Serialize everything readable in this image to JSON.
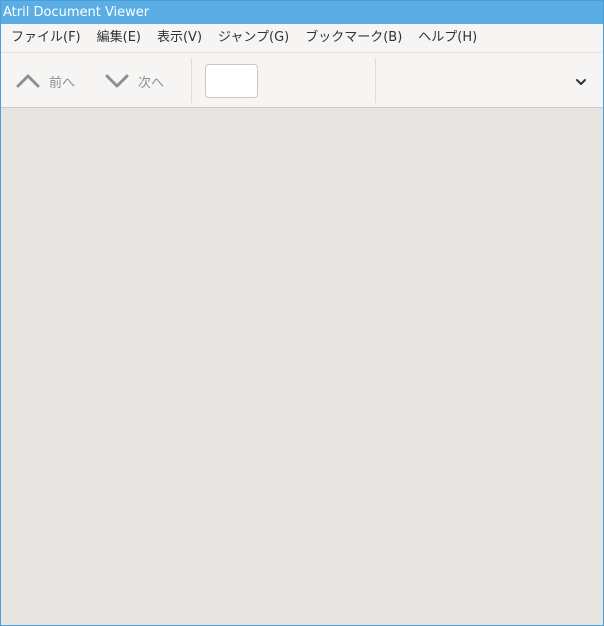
{
  "window": {
    "title": "Atril Document Viewer"
  },
  "menubar": {
    "items": [
      {
        "label": "ファイル(F)"
      },
      {
        "label": "編集(E)"
      },
      {
        "label": "表示(V)"
      },
      {
        "label": "ジャンプ(G)"
      },
      {
        "label": "ブックマーク(B)"
      },
      {
        "label": "ヘルプ(H)"
      }
    ]
  },
  "toolbar": {
    "prev_label": "前へ",
    "prev_icon": "chevron-up-icon",
    "next_label": "次へ",
    "next_icon": "chevron-down-icon",
    "page_entry_value": "",
    "menu_icon": "chevron-down-icon"
  },
  "colors": {
    "titlebar": "#5aaee4",
    "window_border": "#4a9fd9",
    "toolbar_bg": "#f6f5f4",
    "document_bg": "#e8e4e1",
    "disabled_text": "#8f8f8f"
  }
}
